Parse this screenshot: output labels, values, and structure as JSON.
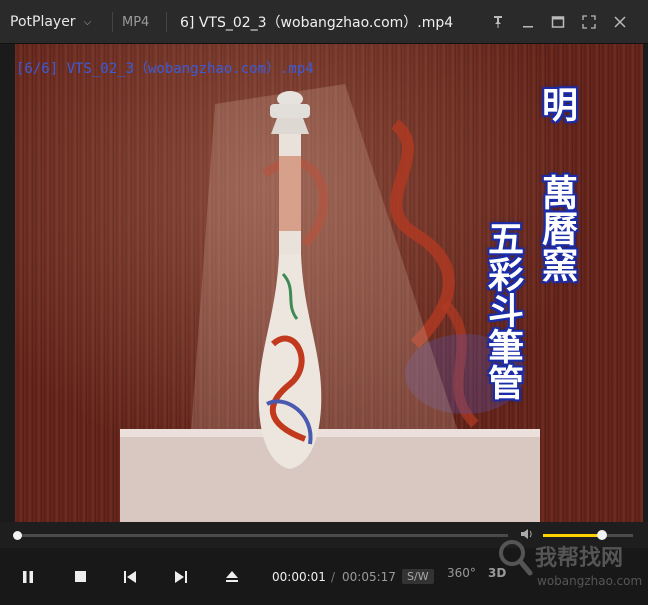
{
  "titlebar": {
    "app_name": "PotPlayer",
    "format": "MP4",
    "window_title": "6] VTS_02_3（wobangzhao.com）.mp4",
    "buttons": [
      "pin-icon",
      "minimize-icon",
      "maximize-icon",
      "fullscreen-icon",
      "close-icon"
    ]
  },
  "video": {
    "osd_text": "[6/6] VTS_02_3（wobangzhao.com）.mp4",
    "caption_col1": "明",
    "caption_col2": "萬曆窯",
    "caption_col3": "五彩斗筆管"
  },
  "playback": {
    "current_time": "00:00:01",
    "separator": "/",
    "total_time": "00:05:17",
    "sw_label": "S/W",
    "label_360": "360°",
    "label_3d": "3D",
    "progress": 0.003,
    "volume": 0.66
  },
  "watermark": {
    "main": "我帮找网",
    "sub": "wobangzhao.com"
  },
  "colors": {
    "accent_volume": "#ffd200",
    "osd": "#3b5bd8"
  }
}
